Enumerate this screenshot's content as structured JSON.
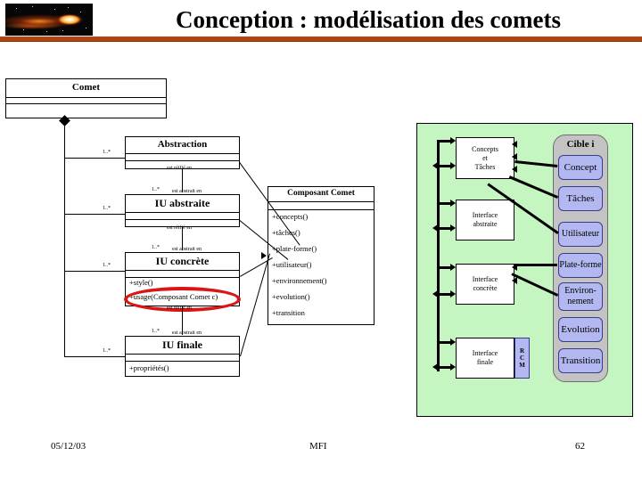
{
  "slide": {
    "title": "Conception : modélisation des comets",
    "accent_color": "#b3430f",
    "panel_color": "#c5f5c0",
    "target_panel_color": "#c3c3c3",
    "target_item_color": "#b3b8f0",
    "highlight_color": "#d81616"
  },
  "header": {
    "image_name": "comet-banner-image"
  },
  "uml": {
    "root": {
      "name": "Comet"
    },
    "classes": [
      {
        "name": "Abstraction",
        "members": []
      },
      {
        "name": "IU abstraite",
        "members": []
      },
      {
        "name": "IU concrète",
        "members": [
          "+style()",
          "+usage(Composant Comet c)"
        ]
      },
      {
        "name": "IU finale",
        "members": [
          "+propriétés()"
        ]
      }
    ],
    "component": {
      "name": "Composant Comet",
      "members": [
        "+concepts()",
        "+tâches()",
        "+plate-forme()",
        "+utilisateur()",
        "+environnement()",
        "+evolution()",
        "+transition"
      ]
    },
    "multiplicity": "1..*",
    "relations": {
      "reified": "est réifié en",
      "abstracted": "est abstrait en"
    },
    "highlight_member": "+usage(Composant Comet c)"
  },
  "panel": {
    "layers": [
      {
        "label": "Concepts\net\nTâches"
      },
      {
        "label": "Interface\nabstraite"
      },
      {
        "label": "Interface\nconcrète"
      },
      {
        "label": "Interface\nfinale"
      }
    ],
    "rcm": [
      "R",
      "C",
      "M"
    ],
    "target": {
      "title": "Cible i",
      "items": [
        "Concept",
        "Tâches",
        "Utilisateur",
        "Plate-forme",
        "Environ-\nnement",
        "Evolution",
        "Transition"
      ]
    }
  },
  "footer": {
    "date": "05/12/03",
    "center": "MFI",
    "page": "62"
  }
}
